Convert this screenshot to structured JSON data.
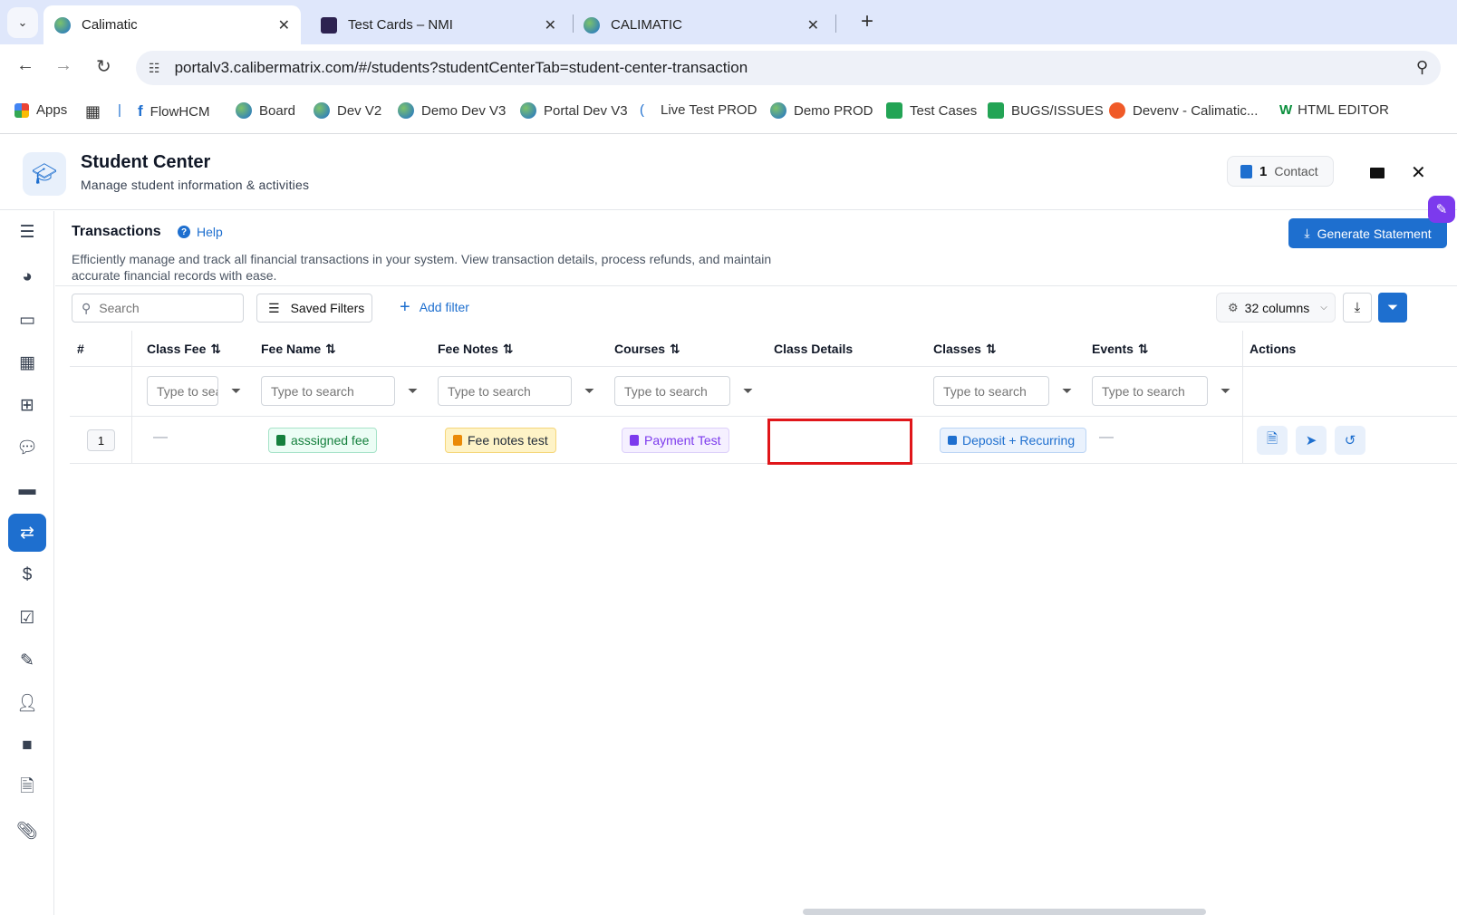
{
  "browser": {
    "tabs": [
      {
        "title": "Calimatic",
        "active": true
      },
      {
        "title": "Test Cards – NMI",
        "active": false
      },
      {
        "title": "CALIMATIC",
        "active": false
      }
    ],
    "url": "portalv3.calibermatrix.com/#/students?studentCenterTab=student-center-transaction",
    "bookmarks": [
      "Apps",
      "FlowHCM",
      "Board",
      "Dev V2",
      "Demo Dev V3",
      "Portal Dev V3",
      "Live Test PROD",
      "Demo PROD",
      "Test Cases",
      "BUGS/ISSUES",
      "Devenv - Calimatic...",
      "HTML EDITOR"
    ]
  },
  "header": {
    "title": "Student Center",
    "subtitle": "Manage student information & activities",
    "contact_count": "1",
    "contact_label": "Contact"
  },
  "section": {
    "title": "Transactions",
    "help": "Help",
    "description": "Efficiently manage and track all financial transactions in your system. View transaction details, process refunds, and maintain accurate financial records with ease.",
    "generate_label": "Generate Statement"
  },
  "toolbar": {
    "search_placeholder": "Search",
    "saved_filters": "Saved Filters",
    "add_filter": "Add filter",
    "columns_label": "32 columns"
  },
  "table": {
    "headers": {
      "num": "#",
      "class_fee": "Class Fee",
      "fee_name": "Fee Name",
      "fee_notes": "Fee Notes",
      "courses": "Courses",
      "class_details": "Class Details",
      "classes": "Classes",
      "events": "Events",
      "actions": "Actions"
    },
    "filter_placeholder": "Type to search",
    "rows": [
      {
        "num": "1",
        "class_fee": "—",
        "fee_name": "asssigned fee",
        "fee_notes": "Fee notes test",
        "courses": "Payment Test",
        "class_details": "",
        "classes": "Deposit + Recurring",
        "events": "—"
      }
    ]
  },
  "colors": {
    "primary": "#1e6fcf",
    "highlight": "#e0161a",
    "accent_purple": "#7c3aed"
  }
}
